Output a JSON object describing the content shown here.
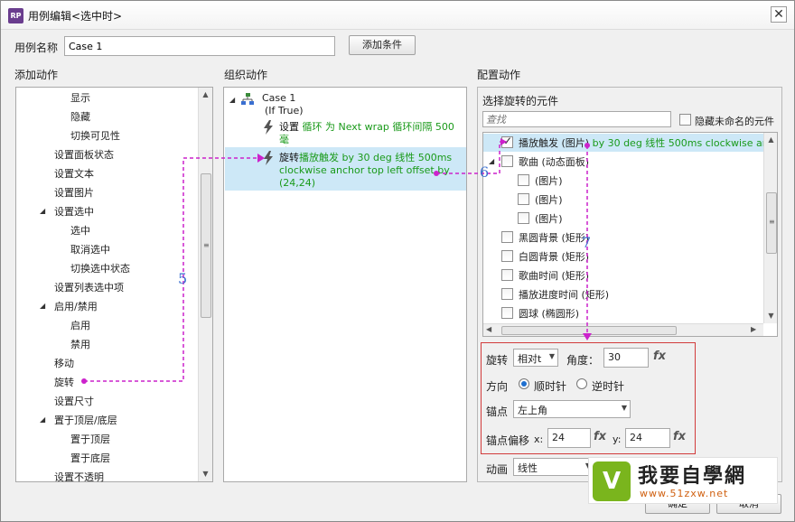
{
  "window": {
    "title": "用例编辑<选中时>",
    "icon_text": "RP",
    "close_glyph": "✕"
  },
  "case": {
    "label": "用例名称",
    "value": "Case 1",
    "add_condition": "添加条件"
  },
  "sections": {
    "add_action": "添加动作",
    "organize_action": "组织动作",
    "configure_action": "配置动作"
  },
  "add_actions": [
    {
      "label": "显示",
      "indent": 2
    },
    {
      "label": "隐藏",
      "indent": 2
    },
    {
      "label": "切换可见性",
      "indent": 2
    },
    {
      "label": "设置面板状态",
      "indent": 1
    },
    {
      "label": "设置文本",
      "indent": 1
    },
    {
      "label": "设置图片",
      "indent": 1
    },
    {
      "label": "设置选中",
      "indent": 1,
      "expanded": true
    },
    {
      "label": "选中",
      "indent": 2
    },
    {
      "label": "取消选中",
      "indent": 2
    },
    {
      "label": "切换选中状态",
      "indent": 2
    },
    {
      "label": "设置列表选中项",
      "indent": 1
    },
    {
      "label": "启用/禁用",
      "indent": 1,
      "expanded": true
    },
    {
      "label": "启用",
      "indent": 2
    },
    {
      "label": "禁用",
      "indent": 2
    },
    {
      "label": "移动",
      "indent": 1
    },
    {
      "label": "旋转",
      "indent": 1
    },
    {
      "label": "设置尺寸",
      "indent": 1
    },
    {
      "label": "置于顶层/底层",
      "indent": 1,
      "expanded": true
    },
    {
      "label": "置于顶层",
      "indent": 2
    },
    {
      "label": "置于底层",
      "indent": 2
    },
    {
      "label": "设置不透明",
      "indent": 1
    }
  ],
  "organize": {
    "case_name": "Case 1",
    "condition": "(If True)",
    "action1": {
      "prefix": "设置 ",
      "line1": "循环 为 Next wrap 循环间隔 500 毫",
      "line2": "秒"
    },
    "action2": {
      "prefix": "旋转",
      "line1": "播放触发 by 30 deg 线性 500ms",
      "line2": "clockwise anchor top left offset by",
      "line3": "(24,24)"
    }
  },
  "configure": {
    "select_label": "选择旋转的元件",
    "search_placeholder": "查找",
    "hide_unnamed": "隐藏未命名的元件",
    "widgets": [
      {
        "name": "播放触发 (图片)",
        "detail": " by 30 deg 线性 500ms clockwise anch",
        "checked": true,
        "indent": 0
      },
      {
        "name": "歌曲 (动态面板)",
        "detail": "",
        "checked": false,
        "indent": 0,
        "expanded": true
      },
      {
        "name": "(图片)",
        "detail": "",
        "checked": false,
        "indent": 1
      },
      {
        "name": "(图片)",
        "detail": "",
        "checked": false,
        "indent": 1
      },
      {
        "name": "(图片)",
        "detail": "",
        "checked": false,
        "indent": 1
      },
      {
        "name": "黑圆背景 (矩形)",
        "detail": "",
        "checked": false,
        "indent": 0
      },
      {
        "name": "白圆背景 (矩形)",
        "detail": "",
        "checked": false,
        "indent": 0
      },
      {
        "name": "歌曲时间 (矩形)",
        "detail": "",
        "checked": false,
        "indent": 0
      },
      {
        "name": "播放进度时间 (矩形)",
        "detail": "",
        "checked": false,
        "indent": 0
      },
      {
        "name": "圆球 (椭圆形)",
        "detail": "",
        "checked": false,
        "indent": 0
      }
    ],
    "rotate_label": "旋转",
    "rotate_mode": "相对t",
    "angle_label": "角度：",
    "angle_value": "30",
    "direction_label": "方向",
    "clockwise": "顺时针",
    "counter_clockwise": "逆时针",
    "anchor_label": "锚点",
    "anchor_value": "左上角",
    "offset_label": "锚点偏移",
    "x_label": "x:",
    "x_value": "24",
    "y_label": "y:",
    "y_value": "24",
    "fx": "fx",
    "animation_label": "动画",
    "animation_value": "线性"
  },
  "annotations": {
    "n5": "5",
    "n6": "6",
    "n7": "7"
  },
  "footer": {
    "ok": "确定",
    "cancel": "取消"
  },
  "watermark": {
    "mark": "V",
    "text": "我要自學網",
    "url": "www.51zxw.net"
  },
  "colors": {
    "selection": "#cde8f7",
    "action_green": "#1a9a1a",
    "annotation_purple": "#cc22cc",
    "highlight_red": "#d23b3b"
  }
}
